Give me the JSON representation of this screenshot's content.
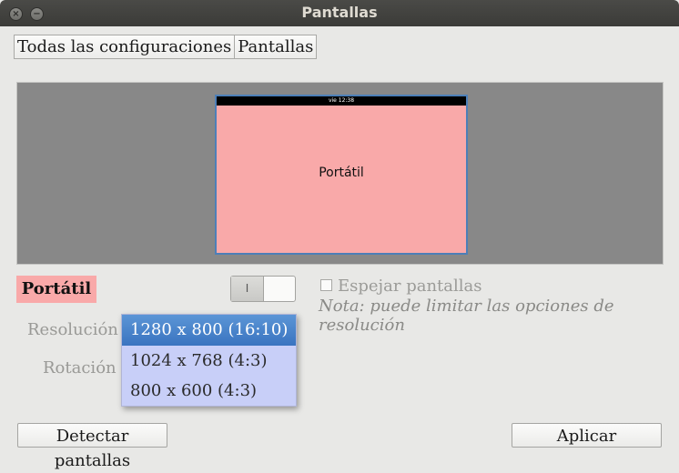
{
  "window": {
    "title": "Pantallas"
  },
  "breadcrumb": {
    "items": [
      "Todas las configuraciones",
      "Pantallas"
    ]
  },
  "preview": {
    "topbar_clock": "vie 12:38",
    "monitor_label": "Portátil",
    "monitor_color": "#f9a9a9"
  },
  "display": {
    "name": "Portátil",
    "toggle_glyph": "I"
  },
  "mirror": {
    "label": "Espejar pantallas",
    "checked": false
  },
  "note": "Nota: puede limitar las opciones de resolución",
  "resolution": {
    "label": "Resolución",
    "options": [
      "1280 x 800 (16:10)",
      "1024 x 768 (4:3)",
      "800 x 600 (4:3)"
    ],
    "selected": "1280 x 800 (16:10)"
  },
  "rotation": {
    "label": "Rotación"
  },
  "buttons": {
    "detect": "Detectar pantallas",
    "apply": "Aplicar"
  },
  "colors": {
    "selection": "#3a74c0",
    "dropdown_bg": "#c8cff8",
    "titlebar": "#3b3b38"
  },
  "icons": {
    "close": "close-icon",
    "minimize": "minimize-icon"
  }
}
